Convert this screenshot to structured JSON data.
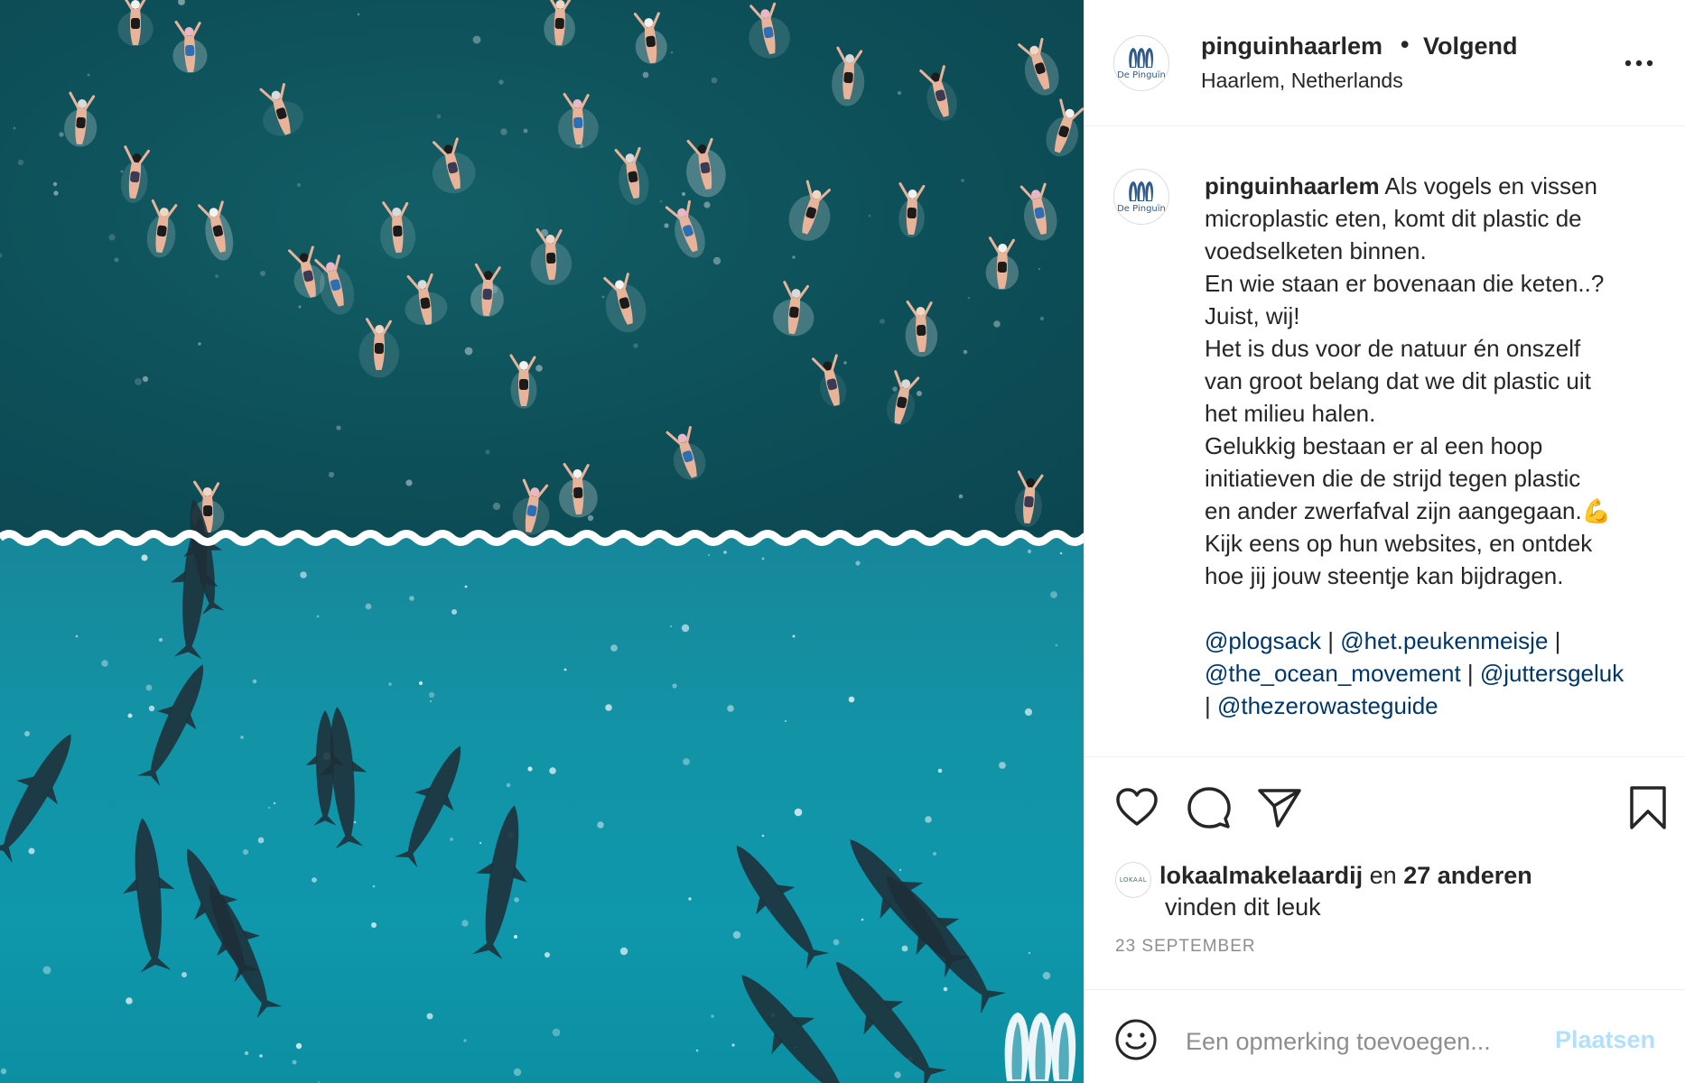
{
  "post": {
    "image_alt": "Aerial photo: swimmers in open water above, dolphins below, separated by a wavy white line",
    "watermark_icon": "penguins-logo-icon"
  },
  "header": {
    "username": "pinguinhaarlem",
    "separator": "•",
    "follow_label": "Volgend",
    "location": "Haarlem, Netherlands",
    "avatar_text": "De Pinguïn",
    "more_icon": "more-options-icon"
  },
  "caption": {
    "username": "pinguinhaarlem",
    "avatar_text": "De Pinguïn",
    "lines": [
      " Als vogels en vissen",
      "microplastic eten, komt dit plastic de",
      "voedselketen binnen.",
      "En wie staan er bovenaan die keten..?",
      "Juist, wij!",
      "Het is dus voor de natuur én onszelf",
      "van groot belang dat we dit plastic uit",
      "het milieu halen.",
      "Gelukkig bestaan er al een hoop",
      "initiatieven die de strijd tegen plastic",
      "en ander zwerfafval zijn aangegaan.",
      "Kijk eens op hun websites, en ontdek",
      "hoe jij jouw steentje kan bijdragen."
    ],
    "emoji": "💪",
    "mentions": {
      "m1": "@plogsack",
      "sep1": " | ",
      "m2": "@het.peukenmeisje",
      "sep2": " |",
      "m3": "@the_ocean_movement",
      "sep3": " | ",
      "m4": "@juttersgeluk",
      "sep4": "| ",
      "m5": "@thezerowasteguide"
    }
  },
  "actions": {
    "like_icon": "heart-icon",
    "comment_icon": "comment-icon",
    "share_icon": "send-icon",
    "save_icon": "bookmark-icon"
  },
  "likes": {
    "avatar_text": "LOKAAL",
    "liker": "lokaalmakelaardij",
    "middle": " en ",
    "others": "27 anderen",
    "suffix": "vinden dit leuk"
  },
  "date": "23 SEPTEMBER",
  "comment": {
    "placeholder": "Een opmerking toevoegen...",
    "post_label": "Plaatsen",
    "emoji_icon": "smiley-icon"
  }
}
